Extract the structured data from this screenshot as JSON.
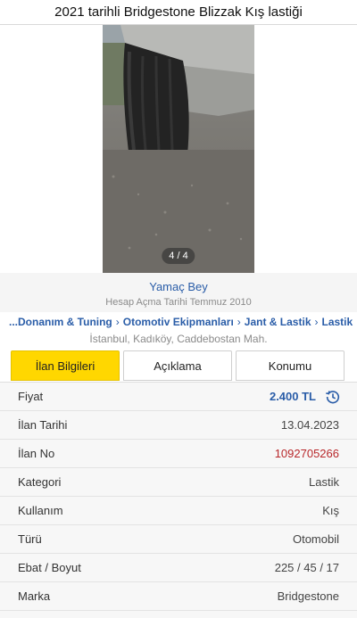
{
  "header": {
    "title": "2021 tarihli Bridgestone Blizzak Kış lastiği"
  },
  "gallery": {
    "counter": "4 / 4"
  },
  "seller": {
    "name": "Yamaç Bey",
    "since": "Hesap Açma Tarihi  Temmuz 2010"
  },
  "breadcrumb": {
    "items": [
      "...Donanım & Tuning",
      "Otomotiv Ekipmanları",
      "Jant & Lastik",
      "Lastik"
    ]
  },
  "location": "İstanbul, Kadıköy, Caddebostan Mah.",
  "tabs": [
    {
      "label": "İlan Bilgileri",
      "active": true
    },
    {
      "label": "Açıklama",
      "active": false
    },
    {
      "label": "Konumu",
      "active": false
    }
  ],
  "details": [
    {
      "key": "Fiyat",
      "value": "2.400 TL"
    },
    {
      "key": "İlan Tarihi",
      "value": "13.04.2023"
    },
    {
      "key": "İlan No",
      "value": "1092705266"
    },
    {
      "key": "Kategori",
      "value": "Lastik"
    },
    {
      "key": "Kullanım",
      "value": "Kış"
    },
    {
      "key": "Türü",
      "value": "Otomobil"
    },
    {
      "key": "Ebat / Boyut",
      "value": "225 / 45 / 17"
    },
    {
      "key": "Marka",
      "value": "Bridgestone"
    }
  ],
  "colors": {
    "accent": "#ffd700",
    "link": "#2a5da8",
    "ad_no": "#b8282b"
  },
  "icons": {
    "price_history": "history-icon"
  }
}
